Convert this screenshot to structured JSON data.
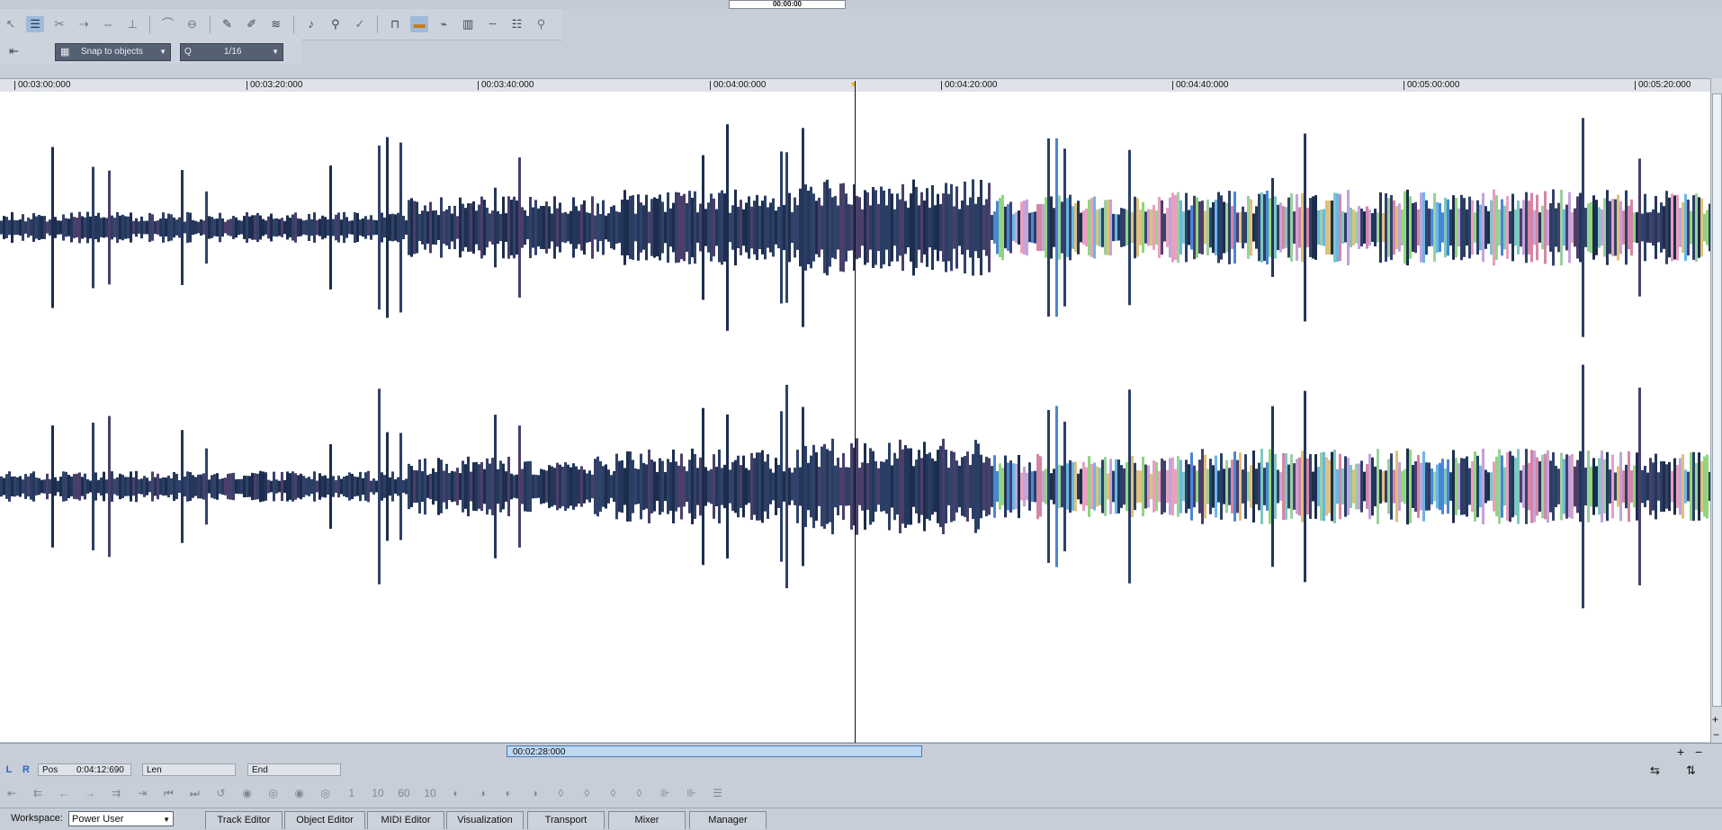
{
  "toolbar": {
    "timecode": "00:00:00",
    "snap_mode": "Snap to objects",
    "quantize_label": "Q",
    "quantize_value": "1/16"
  },
  "ruler": {
    "ticks": [
      "00:03:00:000",
      "00:03:20:000",
      "00:03:40:000",
      "00:04:00:000",
      "00:04:20:000",
      "00:04:40:000",
      "00:05:00:000",
      "00:05:20:000"
    ]
  },
  "scroll": {
    "visible_range": "00:02:28:000"
  },
  "position": {
    "left_label": "L",
    "right_label": "R",
    "pos_label": "Pos",
    "pos_value": "0:04:12:690",
    "len_label": "Len",
    "end_label": "End"
  },
  "workspace": {
    "label": "Workspace:",
    "value": "Power User"
  },
  "tabs": [
    "Track Editor",
    "Object Editor",
    "MIDI Editor",
    "Visualization",
    "Transport",
    "Mixer",
    "Manager"
  ],
  "icons": {
    "toolbar": [
      "pointer-icon",
      "range-icon",
      "cut-icon",
      "draw-icon",
      "pen-icon",
      "pencil-icon",
      "scrub-icon",
      "speaker-icon",
      "zoom-icon",
      "check-icon",
      "tempo-icon",
      "color-icon",
      "curve-icon",
      "grid-icon",
      "bars-icon",
      "list-icon",
      "search-icon"
    ],
    "transport": [
      "go-start-icon",
      "rewind-icon",
      "prev-icon",
      "next-icon",
      "forward-icon",
      "go-end-icon",
      "marker-prev-icon",
      "marker-next-icon",
      "loop-icon",
      "record-icon"
    ]
  },
  "colors": {
    "waveform_primary": "#1c2d4d",
    "playhead_marker": "#e5b800",
    "selection": "#bcd8f3"
  }
}
